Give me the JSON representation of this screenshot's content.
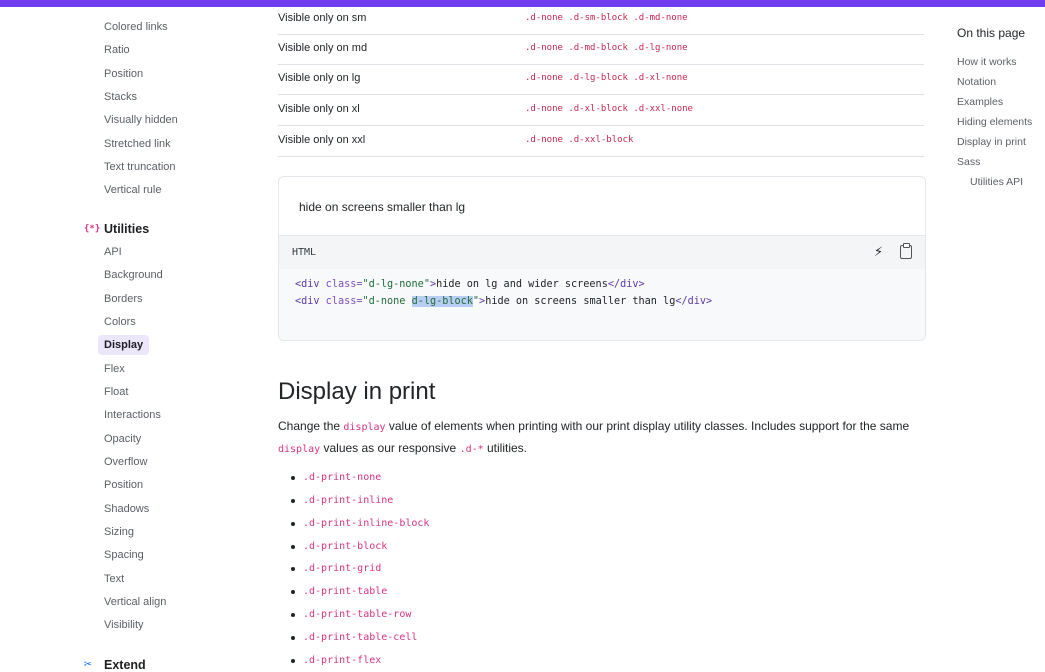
{
  "colors": {
    "accent": "#6f3cf0",
    "code_pink": "#d63384",
    "active_bg": "#ece6fb"
  },
  "sidebar": {
    "top_items": [
      "Colored links",
      "Ratio",
      "Position",
      "Stacks",
      "Visually hidden",
      "Stretched link",
      "Text truncation",
      "Vertical rule"
    ],
    "utilities": {
      "title": "Utilities",
      "icon": "braces-asterisk-icon",
      "items": [
        "API",
        "Background",
        "Borders",
        "Colors",
        "Display",
        "Flex",
        "Float",
        "Interactions",
        "Opacity",
        "Overflow",
        "Position",
        "Shadows",
        "Sizing",
        "Spacing",
        "Text",
        "Vertical align",
        "Visibility"
      ],
      "active": "Display"
    },
    "extend": {
      "title": "Extend",
      "icon": "tools-icon"
    }
  },
  "table": {
    "rows": [
      {
        "label": "Visible only on sm",
        "classes": ".d-none .d-sm-block .d-md-none"
      },
      {
        "label": "Visible only on md",
        "classes": ".d-none .d-md-block .d-lg-none"
      },
      {
        "label": "Visible only on lg",
        "classes": ".d-none .d-lg-block .d-xl-none"
      },
      {
        "label": "Visible only on xl",
        "classes": ".d-none .d-xl-block .d-xxl-none"
      },
      {
        "label": "Visible only on xxl",
        "classes": ".d-none .d-xxl-block"
      }
    ]
  },
  "example": {
    "preview_text": "hide on screens smaller than lg",
    "lang": "HTML",
    "icons": [
      "lightning-icon",
      "clipboard-icon"
    ],
    "code": {
      "line1": {
        "open": "<div",
        "attr": " class=",
        "value": "\"d-lg-none\"",
        "close": ">",
        "text": "hide on lg and wider screens",
        "end": "</div>"
      },
      "line2": {
        "open": "<div",
        "attr": " class=",
        "value_pre": "\"d-none ",
        "value_hl": "d-lg-block",
        "value_post": "\"",
        "close": ">",
        "text": "hide on screens smaller than lg",
        "end": "</div>"
      }
    }
  },
  "print_section": {
    "title": "Display in print",
    "para_1": "Change the ",
    "para_code_1": "display",
    "para_2": " value of elements when printing with our print display utility classes. Includes support for the same ",
    "para_code_2": "display",
    "para_3": " values as our responsive ",
    "para_code_3": ".d-*",
    "para_4": " utilities.",
    "classes": [
      ".d-print-none",
      ".d-print-inline",
      ".d-print-inline-block",
      ".d-print-block",
      ".d-print-grid",
      ".d-print-table",
      ".d-print-table-row",
      ".d-print-table-cell",
      ".d-print-flex"
    ]
  },
  "toc": {
    "title": "On this page",
    "items": [
      "How it works",
      "Notation",
      "Examples",
      "Hiding elements",
      "Display in print",
      "Sass"
    ],
    "sub_items": [
      "Utilities API"
    ]
  }
}
